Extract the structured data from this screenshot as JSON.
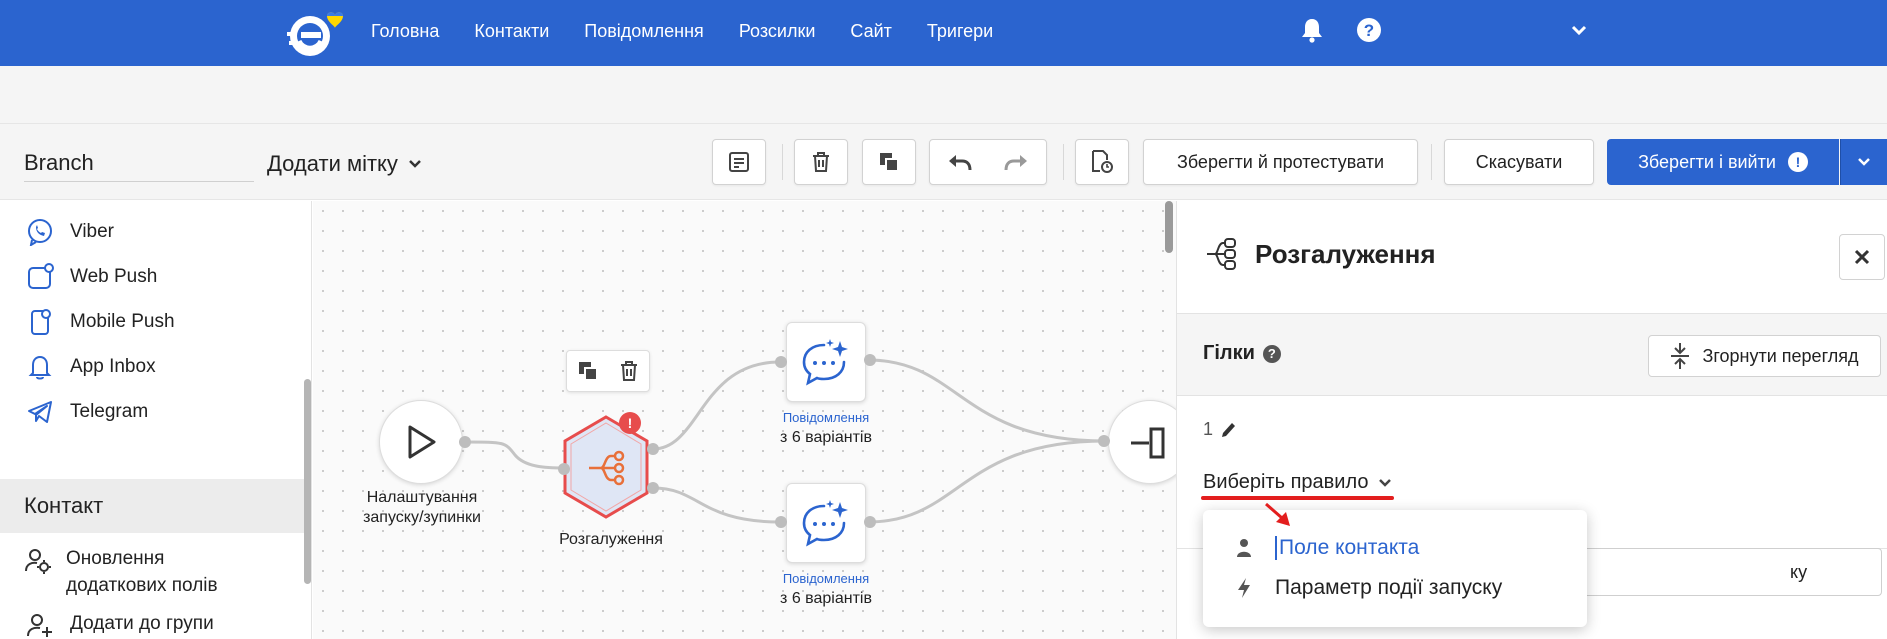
{
  "colors": {
    "brand": "#2b64cf",
    "error": "#e31e1e",
    "node_selected": "#e74c4c",
    "node_branch_fill": "#dfe6f5",
    "branch_icon": "#e8703a"
  },
  "nav": {
    "links": [
      "Головна",
      "Контакти",
      "Повідомлення",
      "Розсилки",
      "Сайт",
      "Тригери"
    ],
    "icons": [
      "logo-icon",
      "bell-icon",
      "help-icon",
      "chevron-down-icon"
    ]
  },
  "toolbar": {
    "workflow_name": "Branch",
    "add_tag": "Додати мітку",
    "save_test": "Зберегти й протестувати",
    "cancel": "Скасувати",
    "save_exit": "Зберегти і вийти"
  },
  "sidebar": {
    "channels": [
      {
        "label": "Viber",
        "icon": "viber-icon"
      },
      {
        "label": "Web Push",
        "icon": "web-push-icon"
      },
      {
        "label": "Mobile Push",
        "icon": "mobile-push-icon"
      },
      {
        "label": "App Inbox",
        "icon": "app-inbox-icon"
      },
      {
        "label": "Telegram",
        "icon": "telegram-icon"
      }
    ],
    "section": "Контакт",
    "contact_actions": [
      {
        "label": "Оновлення додаткових полів",
        "icon": "user-gear-icon"
      },
      {
        "label": "Додати до групи",
        "icon": "user-add-icon"
      }
    ]
  },
  "canvas": {
    "start_node": {
      "label": "Налаштування запуску/зупинки",
      "icon": "play-icon"
    },
    "branch_node": {
      "label": "Розгалуження",
      "badge": "!",
      "icon": "branch-icon"
    },
    "message_nodes": [
      {
        "title": "Повідомлення",
        "subtitle": "з 6 варіантів",
        "icon": "ai-message-icon"
      },
      {
        "title": "Повідомлення",
        "subtitle": "з 6 варіантів",
        "icon": "ai-message-icon"
      }
    ],
    "end_node": {
      "icon": "exit-icon"
    },
    "floatbar_icons": [
      "copy-icon",
      "trash-icon"
    ]
  },
  "panel": {
    "title": "Розгалуження",
    "branches_title": "Гілки",
    "collapse_label": "Згорнути перегляд",
    "branch_number": "1",
    "rule_select": "Виберіть правило",
    "under_input_text": "ку"
  },
  "dropdown": {
    "items": [
      {
        "label": "Поле контакта",
        "icon": "user-icon"
      },
      {
        "label": "Параметр події запуску",
        "icon": "lightning-icon"
      }
    ]
  }
}
